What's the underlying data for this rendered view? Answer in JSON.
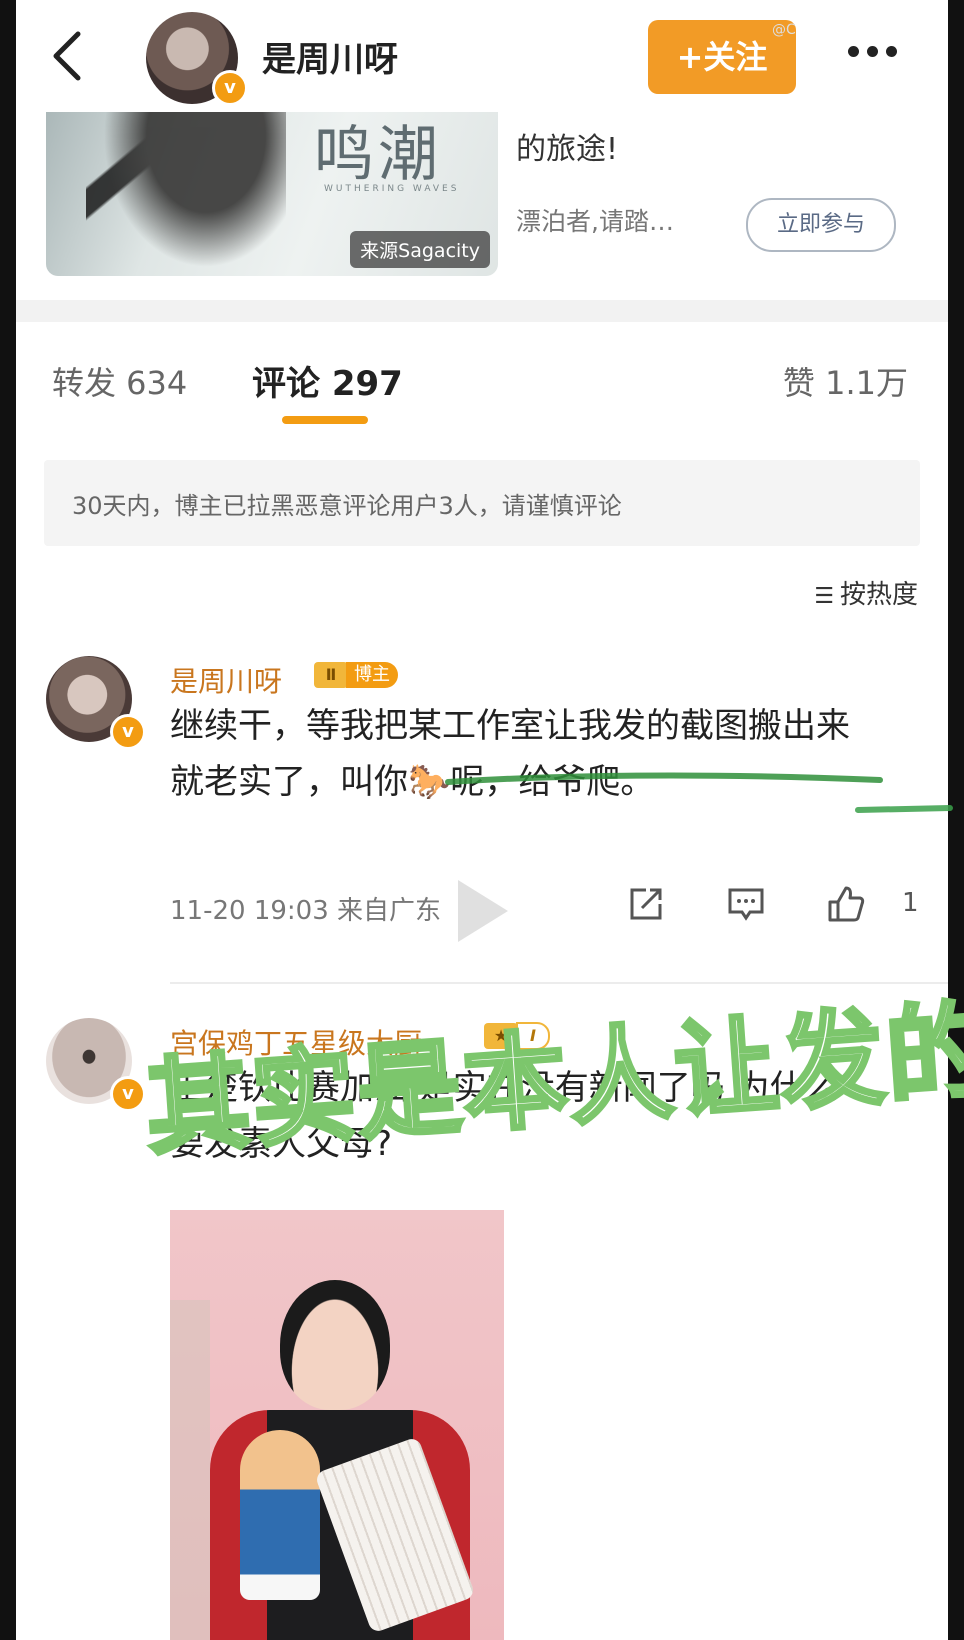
{
  "header": {
    "title": "是周川呀",
    "follow_label": "+关注",
    "watermark_tag": "@C"
  },
  "card": {
    "image_logo": "鸣潮",
    "image_sub": "WUTHERING WAVES",
    "image_source": "来源Sagacity",
    "line1": "的旅途!",
    "line2": "漂泊者,请踏…",
    "join_label": "立即参与"
  },
  "tabs": {
    "repost": "转发 634",
    "comment": "评论 297",
    "like": "赞 1.1万",
    "accent_color": "#f39c12"
  },
  "notice": "30天内，博主已拉黑恶意评论用户3人，请谨慎评论",
  "sort": {
    "icon": "sort-icon",
    "label": "按热度"
  },
  "comments": [
    {
      "name": "是周川呀",
      "badge_level": "Ⅱ",
      "badge_tag": "博主",
      "text": "继续干，等我把某工作室让我发的截图搬出来就老实了，叫你🐎呢，给爷爬。",
      "time": "11-20 19:03",
      "location": "来自广东",
      "like_count": "1"
    },
    {
      "name": "宫保鸡丁五星级大厨",
      "badge_level": "I",
      "text": "王楚钦比赛加油 是实在没有新闻了吗 为什么要发素人父母?"
    }
  ],
  "overlay_text": "其实是本人让发的"
}
